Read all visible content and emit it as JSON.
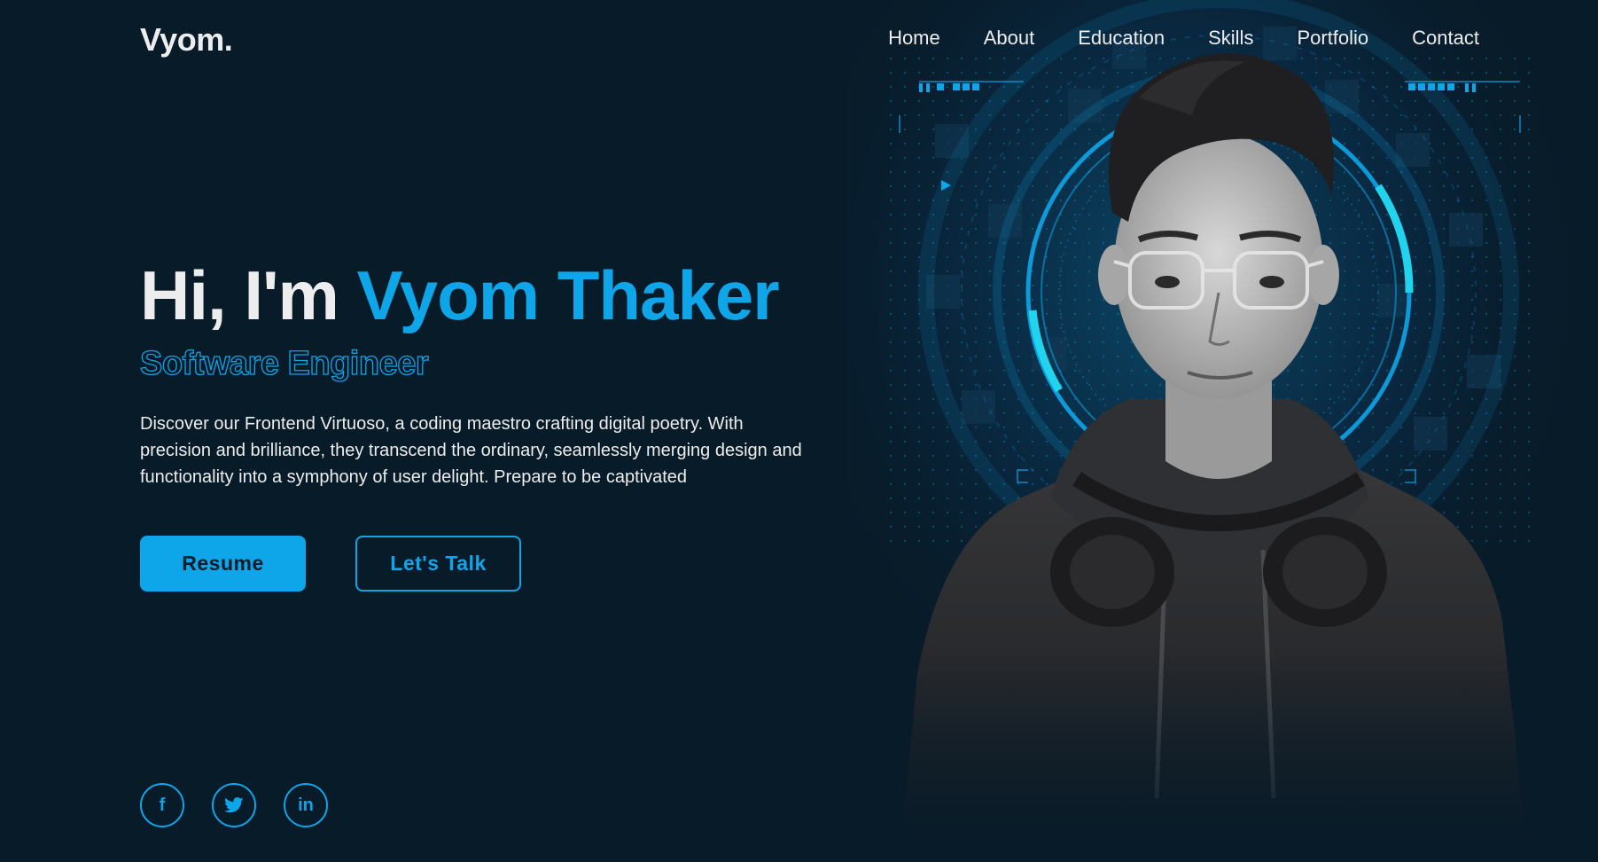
{
  "brand": {
    "logo": "Vyom."
  },
  "nav": {
    "items": [
      {
        "label": "Home"
      },
      {
        "label": "About"
      },
      {
        "label": "Education"
      },
      {
        "label": "Skills"
      },
      {
        "label": "Portfolio"
      },
      {
        "label": "Contact"
      }
    ]
  },
  "hero": {
    "greeting": "Hi, I'm",
    "name": "Vyom Thaker",
    "role": "Software Engineer",
    "description": "Discover our Frontend Virtuoso, a coding maestro crafting digital poetry. With precision and brilliance, they transcend the ordinary, seamlessly merging design and functionality into a symphony of user delight. Prepare to be captivated",
    "primary_button": "Resume",
    "secondary_button": "Let's Talk"
  },
  "social": {
    "facebook_glyph": "f",
    "linkedin_glyph": "in"
  },
  "colors": {
    "background": "#081b29",
    "accent": "#0ea5e9",
    "text": "#ededed"
  },
  "icons": {
    "facebook": "facebook-icon",
    "twitter": "twitter-icon",
    "linkedin": "linkedin-icon"
  }
}
